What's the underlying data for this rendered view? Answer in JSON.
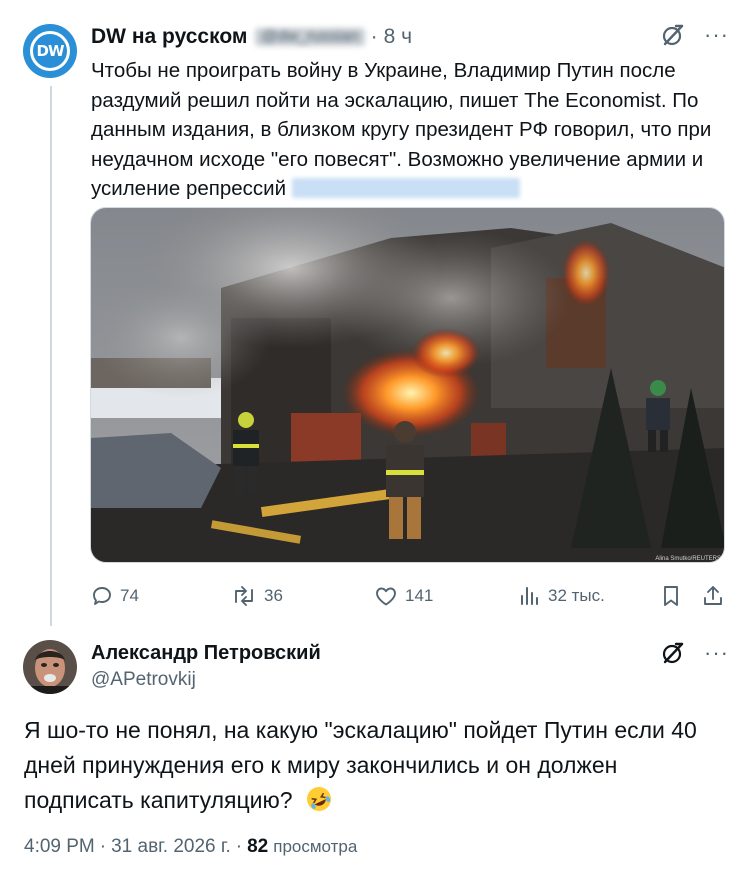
{
  "tweet": {
    "author_name": "DW на русском",
    "handle": "@dw_russian",
    "time": "8 ч",
    "text": "Чтобы не проиграть войну в Украине, Владимир Путин после раздумий решил пойти на эскалацию, пишет The Economist. По данным издания, в близком кругу президент РФ говорил, что при неудачном исходе \"его повесят\". Возможно увеличение армии и усиление репрессий",
    "avatar_label": "DW",
    "image_credit": "Alina Smutko/REUTERS",
    "stats": {
      "replies": "74",
      "retweets": "36",
      "likes": "141",
      "views": "32 тыс."
    }
  },
  "reply": {
    "author_name": "Александр Петровский",
    "handle": "@APetrovkij",
    "text": "Я шо-то не понял, на какую \"эскалацию\" пойдет Путин если 40 дней принуждения его к миру закончились и он должен подписать капитуляцию?",
    "time": "4:09 PM",
    "date": "31 авг. 2026 г.",
    "views_count": "82",
    "views_label": "просмотра"
  },
  "icons": {
    "reply": "speech-bubble-icon",
    "retweet": "retweet-icon",
    "like": "heart-icon",
    "views": "bar-chart-icon",
    "bookmark": "bookmark-icon",
    "share": "share-icon",
    "grok": "grok-icon",
    "more": "more-dots-icon",
    "emoji": "rolling-laughing-emoji"
  },
  "colors": {
    "text": "#0f1419",
    "secondary": "#536471",
    "thread_line": "#cfd9de",
    "dw_blue": "#2a8fd6"
  }
}
